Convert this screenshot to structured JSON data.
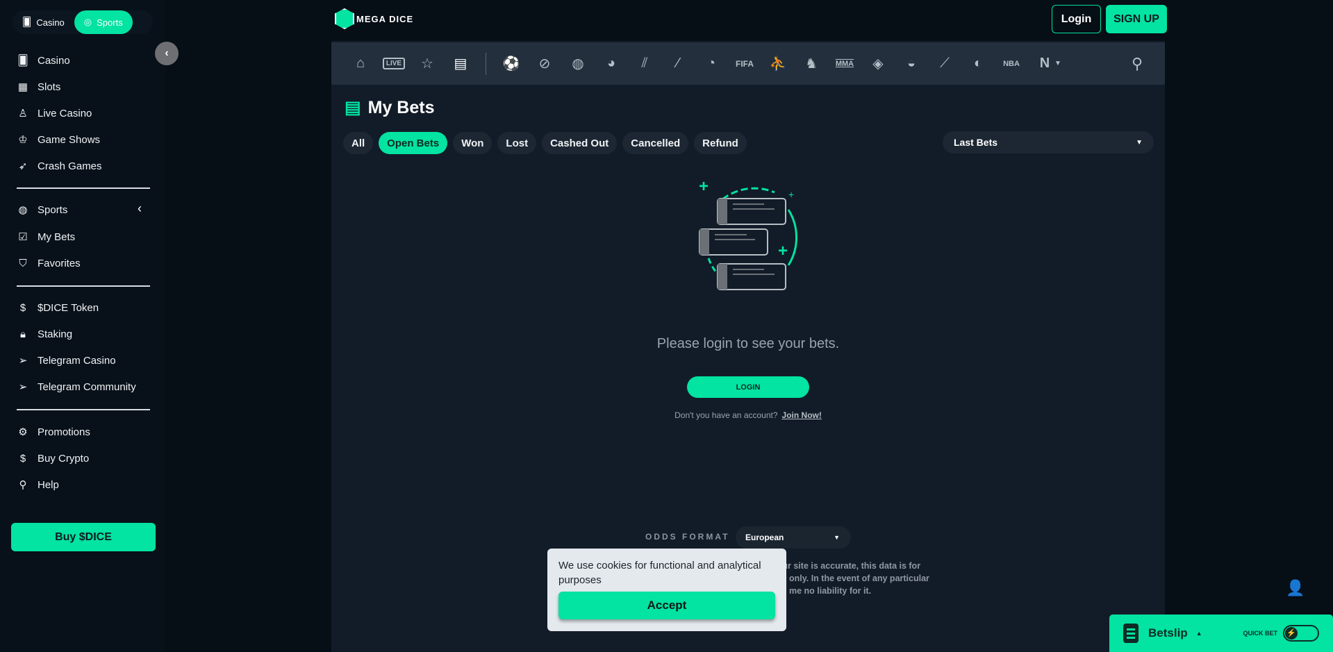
{
  "colors": {
    "accent": "#03e3a1",
    "background": "#060e16",
    "panel": "#121c28"
  },
  "top_toggle": {
    "casino": "Casino",
    "sports": "Sports",
    "active": "Sports"
  },
  "header": {
    "logo_text": "MEGA DICE",
    "login": "Login",
    "signup": "SIGN UP"
  },
  "sidebar": {
    "items": [
      {
        "label": "Casino",
        "icon": "cards-icon"
      },
      {
        "label": "Slots",
        "icon": "slot-machine-icon"
      },
      {
        "label": "Live Casino",
        "icon": "tie-icon"
      },
      {
        "label": "Game Shows",
        "icon": "crown-icon"
      },
      {
        "label": "Crash Games",
        "icon": "rocket-icon"
      },
      {
        "label": "Sports",
        "icon": "basketball-icon"
      },
      {
        "label": "My Bets",
        "icon": "receipt-icon"
      },
      {
        "label": "Favorites",
        "icon": "shield-star-icon"
      },
      {
        "label": "$DICE Token",
        "icon": "dollar-coin-icon"
      },
      {
        "label": "Staking",
        "icon": "lock-icon"
      },
      {
        "label": "Telegram Casino",
        "icon": "telegram-icon"
      },
      {
        "label": "Telegram Community",
        "icon": "telegram-icon"
      },
      {
        "label": "Promotions",
        "icon": "gift-icon"
      },
      {
        "label": "Buy Crypto",
        "icon": "dollar-coin-icon"
      },
      {
        "label": "Help",
        "icon": "search-icon"
      }
    ],
    "buy_button": "Buy $DICE"
  },
  "sports_nav": {
    "live_label": "LIVE",
    "icons": [
      "home",
      "live",
      "star",
      "my-bets",
      "soccer",
      "tennis",
      "basketball",
      "american-football",
      "hockey",
      "baseball",
      "table-tennis",
      "fifa",
      "counter-strike",
      "horse-racing",
      "mma",
      "boxing",
      "volleyball",
      "badminton",
      "rugby",
      "nba2k",
      "esports",
      "more",
      "search"
    ]
  },
  "page": {
    "title": "My Bets",
    "filters": [
      "All",
      "Open Bets",
      "Won",
      "Lost",
      "Cashed Out",
      "Cancelled",
      "Refund"
    ],
    "active_filter": "Open Bets",
    "sort_select": "Last Bets",
    "empty_message": "Please login to see your bets.",
    "login_button": "LOGIN",
    "no_account": "Don't you have an account?",
    "join_now": "Join Now!"
  },
  "footer": {
    "odds_label": "ODDS FORMAT",
    "odds_value": "European",
    "disclaimer_lines": [
      "on our site is accurate, this data is for",
      "only. In the event of any particular",
      "me no liability for it."
    ]
  },
  "cookie": {
    "text": "We use cookies for functional and analytical purposes",
    "accept": "Accept"
  },
  "betslip": {
    "label": "Betslip",
    "quick_bet": "QUICK BET",
    "quick_bet_on": false
  }
}
